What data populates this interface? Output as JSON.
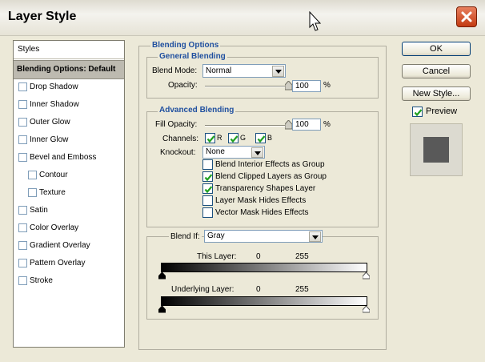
{
  "window": {
    "title": "Layer Style"
  },
  "sidebar": {
    "header": "Styles",
    "selected": "Blending Options: Default",
    "items": [
      {
        "label": "Drop Shadow",
        "checked": false,
        "indent": false
      },
      {
        "label": "Inner Shadow",
        "checked": false,
        "indent": false
      },
      {
        "label": "Outer Glow",
        "checked": false,
        "indent": false
      },
      {
        "label": "Inner Glow",
        "checked": false,
        "indent": false
      },
      {
        "label": "Bevel and Emboss",
        "checked": false,
        "indent": false
      },
      {
        "label": "Contour",
        "checked": false,
        "indent": true
      },
      {
        "label": "Texture",
        "checked": false,
        "indent": true
      },
      {
        "label": "Satin",
        "checked": false,
        "indent": false
      },
      {
        "label": "Color Overlay",
        "checked": false,
        "indent": false
      },
      {
        "label": "Gradient Overlay",
        "checked": false,
        "indent": false
      },
      {
        "label": "Pattern Overlay",
        "checked": false,
        "indent": false
      },
      {
        "label": "Stroke",
        "checked": false,
        "indent": false
      }
    ]
  },
  "blending_options": {
    "title": "Blending Options",
    "general": {
      "title": "General Blending",
      "blend_mode_label": "Blend Mode:",
      "blend_mode": "Normal",
      "opacity_label": "Opacity:",
      "opacity": "100",
      "unit": "%",
      "opacity_fraction": 1.0
    },
    "advanced": {
      "title": "Advanced Blending",
      "fill_opacity_label": "Fill Opacity:",
      "fill_opacity": "100",
      "unit": "%",
      "fill_fraction": 1.0,
      "channels_label": "Channels:",
      "channels": [
        {
          "label": "R",
          "checked": true
        },
        {
          "label": "G",
          "checked": true
        },
        {
          "label": "B",
          "checked": true
        }
      ],
      "knockout_label": "Knockout:",
      "knockout": "None",
      "options": [
        {
          "label": "Blend Interior Effects as Group",
          "checked": false
        },
        {
          "label": "Blend Clipped Layers as Group",
          "checked": true
        },
        {
          "label": "Transparency Shapes Layer",
          "checked": true
        },
        {
          "label": "Layer Mask Hides Effects",
          "checked": false
        },
        {
          "label": "Vector Mask Hides Effects",
          "checked": false
        }
      ]
    },
    "blend_if": {
      "label": "Blend If:",
      "channel": "Gray",
      "this_layer_label": "This Layer:",
      "this_layer_min": "0",
      "this_layer_max": "255",
      "underlying_label": "Underlying Layer:",
      "underlying_min": "0",
      "underlying_max": "255"
    }
  },
  "buttons": {
    "ok": "OK",
    "cancel": "Cancel",
    "new_style": "New Style...",
    "preview_label": "Preview",
    "preview_checked": true
  },
  "colors": {
    "accent_title": "#1f4f9f",
    "check": "#21a121",
    "preview_swatch": "#595959"
  },
  "icons": {
    "close": "close-x-icon",
    "cursor": "mouse-pointer-icon",
    "dropdown": "chevron-down-icon",
    "slider_thumb": "slider-thumb-icon"
  }
}
